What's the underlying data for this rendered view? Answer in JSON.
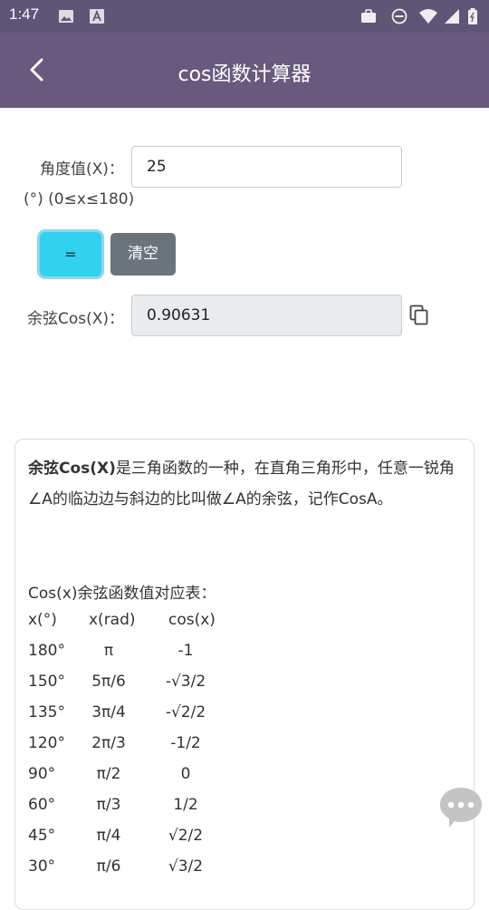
{
  "status_bar": {
    "time": "1:47"
  },
  "app_bar": {
    "title": "cos函数计算器"
  },
  "form": {
    "angle_label": "角度值(X)：",
    "angle_value": "25",
    "angle_hint": "(°) (0≤x≤180)",
    "equals_label": "=",
    "clear_label": "清空",
    "result_label": "余弦Cos(X)：",
    "result_value": "0.90631"
  },
  "description": {
    "bold_term": "余弦Cos(X)",
    "text": "是三角函数的一种，在直角三角形中，任意一锐角∠A的临边边与斜边的比叫做∠A的余弦，记作CosA。",
    "table_title": "Cos(x)余弦函数值对应表：",
    "table_headers": [
      "x(°)",
      "x(rad)",
      "cos(x)"
    ],
    "table_rows": [
      [
        "180°",
        "π",
        "-1"
      ],
      [
        "150°",
        "5π/6",
        "-√3/2"
      ],
      [
        "135°",
        "3π/4",
        "-√2/2"
      ],
      [
        "120°",
        "2π/3",
        "-1/2"
      ],
      [
        "90°",
        "π/2",
        "0"
      ],
      [
        "60°",
        "π/3",
        "1/2"
      ],
      [
        "45°",
        "π/4",
        "√2/2"
      ],
      [
        "30°",
        "π/6",
        "√3/2"
      ]
    ]
  },
  "colors": {
    "app_bar": "#675a7e",
    "status_bar": "#5f5577",
    "equals_button": "#32d1f0",
    "clear_button": "#6b737b"
  },
  "icons": [
    "image-icon",
    "a-icon",
    "briefcase-icon",
    "do-not-disturb-icon",
    "wifi-icon",
    "signal-icon",
    "battery-icon",
    "back-arrow-icon",
    "copy-icon",
    "chat-bubble-icon"
  ]
}
